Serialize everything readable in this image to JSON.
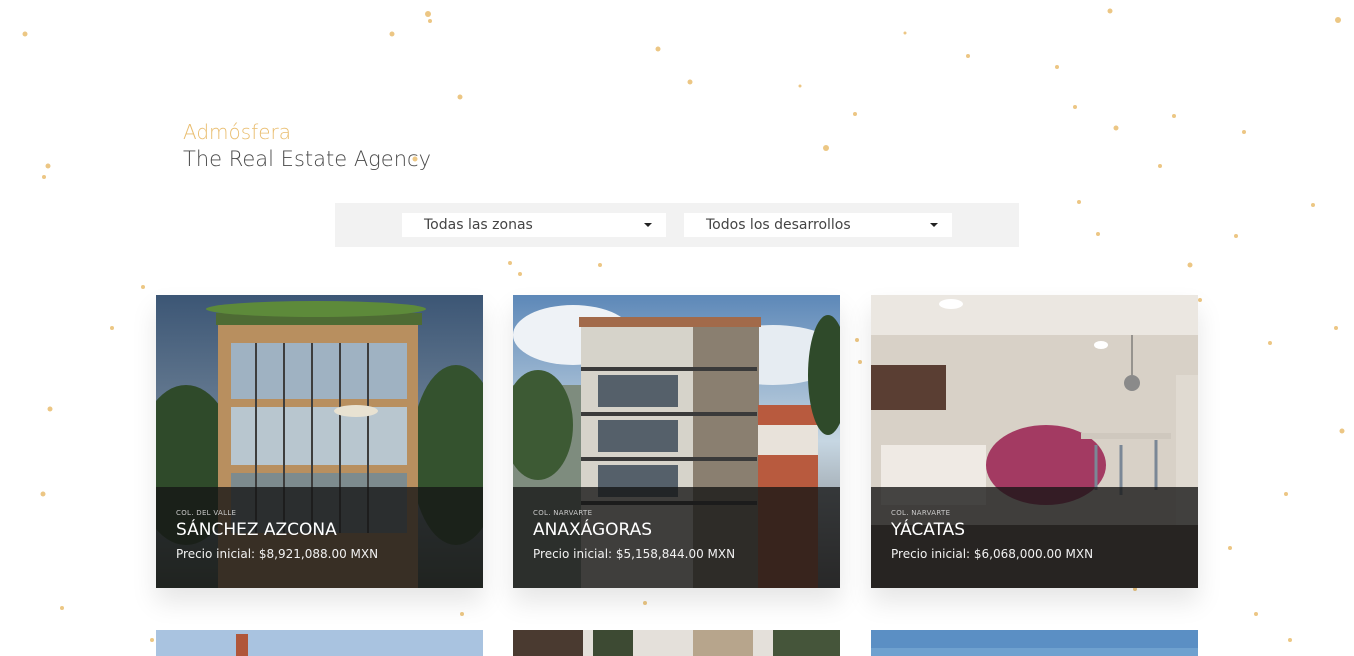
{
  "brand": {
    "name": "Admósfera",
    "tagline": "The Real Estate Agency"
  },
  "filters": {
    "zone_selected": "Todas las zonas",
    "development_selected": "Todos los desarrollos"
  },
  "properties": [
    {
      "area": "COL. DEL VALLE",
      "name": "SÁNCHEZ AZCONA",
      "price": "Precio inicial: $8,921,088.00 MXN"
    },
    {
      "area": "COL. NARVARTE",
      "name": "ANAXÁGORAS",
      "price": "Precio inicial: $5,158,844.00 MXN"
    },
    {
      "area": "COL. NARVARTE",
      "name": "YÁCATAS",
      "price": "Precio inicial: $6,068,000.00 MXN"
    }
  ],
  "colors": {
    "accent": "#e9bd6f",
    "filter_bar": "#f2f2f2",
    "overlay": "#141414"
  }
}
